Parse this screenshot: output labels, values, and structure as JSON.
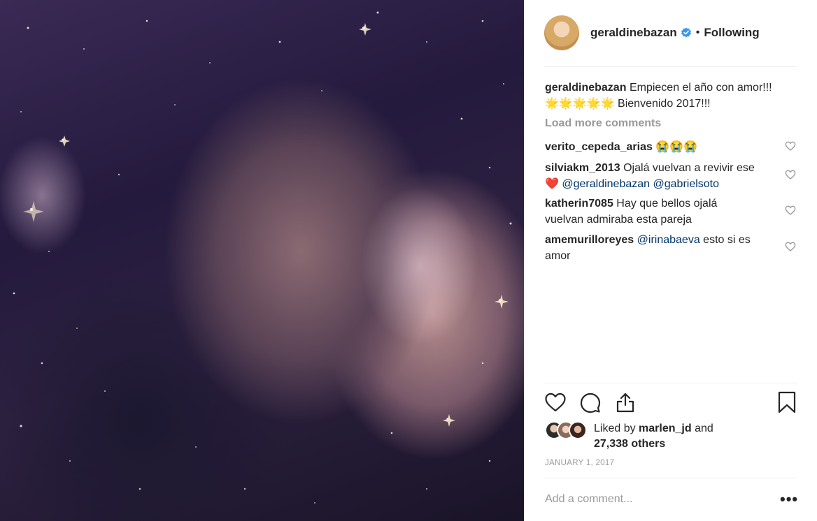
{
  "post": {
    "image_alt": "",
    "author": "geraldinebazan",
    "verified": true,
    "separator": "•",
    "follow_status": "Following",
    "caption_user": "geraldinebazan",
    "caption_line1": "Empiecen el año con amor!!!",
    "caption_line2": "🌟🌟🌟🌟🌟 Bienvenido 2017!!!",
    "load_more": "Load more comments",
    "comments": [
      {
        "user": "verito_cepeda_arias",
        "text": "😭😭😭"
      },
      {
        "user": "silviakm_2013",
        "text": "Ojalá vuelvan a revivir ese",
        "line2_prefix": "❤️",
        "mention1": "@geraldinebazan",
        "mention2": "@gabrielsoto"
      },
      {
        "user": "katherin7085",
        "text": "Hay que bellos ojalá vuelvan admiraba esta pareja"
      },
      {
        "user": "amemurilloreyes",
        "mention1": "@irinabaeva",
        "text": "esto si es amor"
      }
    ],
    "liked_by_prefix": "Liked by",
    "liked_by_user": "marlen_jd",
    "liked_by_and": "and",
    "likes_others": "27,338 others",
    "date": "JANUARY 1, 2017",
    "add_comment_placeholder": "Add a comment...",
    "more_options": "•••"
  },
  "icons": {
    "like": "heart-icon",
    "comment": "comment-icon",
    "share": "share-icon",
    "save": "bookmark-icon",
    "verified": "verified-badge-icon"
  },
  "colors": {
    "mention": "#003569",
    "verified": "#3897f0",
    "muted": "#999999",
    "text": "#262626"
  }
}
